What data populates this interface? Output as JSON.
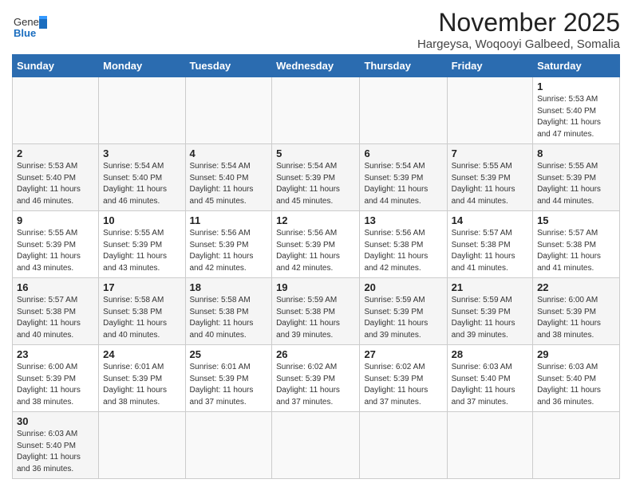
{
  "logo": {
    "general": "General",
    "blue": "Blue"
  },
  "title": "November 2025",
  "subtitle": "Hargeysa, Woqooyi Galbeed, Somalia",
  "header_days": [
    "Sunday",
    "Monday",
    "Tuesday",
    "Wednesday",
    "Thursday",
    "Friday",
    "Saturday"
  ],
  "weeks": [
    [
      {
        "day": "",
        "info": ""
      },
      {
        "day": "",
        "info": ""
      },
      {
        "day": "",
        "info": ""
      },
      {
        "day": "",
        "info": ""
      },
      {
        "day": "",
        "info": ""
      },
      {
        "day": "",
        "info": ""
      },
      {
        "day": "1",
        "info": "Sunrise: 5:53 AM\nSunset: 5:40 PM\nDaylight: 11 hours\nand 47 minutes."
      }
    ],
    [
      {
        "day": "2",
        "info": "Sunrise: 5:53 AM\nSunset: 5:40 PM\nDaylight: 11 hours\nand 46 minutes."
      },
      {
        "day": "3",
        "info": "Sunrise: 5:54 AM\nSunset: 5:40 PM\nDaylight: 11 hours\nand 46 minutes."
      },
      {
        "day": "4",
        "info": "Sunrise: 5:54 AM\nSunset: 5:40 PM\nDaylight: 11 hours\nand 45 minutes."
      },
      {
        "day": "5",
        "info": "Sunrise: 5:54 AM\nSunset: 5:39 PM\nDaylight: 11 hours\nand 45 minutes."
      },
      {
        "day": "6",
        "info": "Sunrise: 5:54 AM\nSunset: 5:39 PM\nDaylight: 11 hours\nand 44 minutes."
      },
      {
        "day": "7",
        "info": "Sunrise: 5:55 AM\nSunset: 5:39 PM\nDaylight: 11 hours\nand 44 minutes."
      },
      {
        "day": "8",
        "info": "Sunrise: 5:55 AM\nSunset: 5:39 PM\nDaylight: 11 hours\nand 44 minutes."
      }
    ],
    [
      {
        "day": "9",
        "info": "Sunrise: 5:55 AM\nSunset: 5:39 PM\nDaylight: 11 hours\nand 43 minutes."
      },
      {
        "day": "10",
        "info": "Sunrise: 5:55 AM\nSunset: 5:39 PM\nDaylight: 11 hours\nand 43 minutes."
      },
      {
        "day": "11",
        "info": "Sunrise: 5:56 AM\nSunset: 5:39 PM\nDaylight: 11 hours\nand 42 minutes."
      },
      {
        "day": "12",
        "info": "Sunrise: 5:56 AM\nSunset: 5:39 PM\nDaylight: 11 hours\nand 42 minutes."
      },
      {
        "day": "13",
        "info": "Sunrise: 5:56 AM\nSunset: 5:38 PM\nDaylight: 11 hours\nand 42 minutes."
      },
      {
        "day": "14",
        "info": "Sunrise: 5:57 AM\nSunset: 5:38 PM\nDaylight: 11 hours\nand 41 minutes."
      },
      {
        "day": "15",
        "info": "Sunrise: 5:57 AM\nSunset: 5:38 PM\nDaylight: 11 hours\nand 41 minutes."
      }
    ],
    [
      {
        "day": "16",
        "info": "Sunrise: 5:57 AM\nSunset: 5:38 PM\nDaylight: 11 hours\nand 40 minutes."
      },
      {
        "day": "17",
        "info": "Sunrise: 5:58 AM\nSunset: 5:38 PM\nDaylight: 11 hours\nand 40 minutes."
      },
      {
        "day": "18",
        "info": "Sunrise: 5:58 AM\nSunset: 5:38 PM\nDaylight: 11 hours\nand 40 minutes."
      },
      {
        "day": "19",
        "info": "Sunrise: 5:59 AM\nSunset: 5:38 PM\nDaylight: 11 hours\nand 39 minutes."
      },
      {
        "day": "20",
        "info": "Sunrise: 5:59 AM\nSunset: 5:39 PM\nDaylight: 11 hours\nand 39 minutes."
      },
      {
        "day": "21",
        "info": "Sunrise: 5:59 AM\nSunset: 5:39 PM\nDaylight: 11 hours\nand 39 minutes."
      },
      {
        "day": "22",
        "info": "Sunrise: 6:00 AM\nSunset: 5:39 PM\nDaylight: 11 hours\nand 38 minutes."
      }
    ],
    [
      {
        "day": "23",
        "info": "Sunrise: 6:00 AM\nSunset: 5:39 PM\nDaylight: 11 hours\nand 38 minutes."
      },
      {
        "day": "24",
        "info": "Sunrise: 6:01 AM\nSunset: 5:39 PM\nDaylight: 11 hours\nand 38 minutes."
      },
      {
        "day": "25",
        "info": "Sunrise: 6:01 AM\nSunset: 5:39 PM\nDaylight: 11 hours\nand 37 minutes."
      },
      {
        "day": "26",
        "info": "Sunrise: 6:02 AM\nSunset: 5:39 PM\nDaylight: 11 hours\nand 37 minutes."
      },
      {
        "day": "27",
        "info": "Sunrise: 6:02 AM\nSunset: 5:39 PM\nDaylight: 11 hours\nand 37 minutes."
      },
      {
        "day": "28",
        "info": "Sunrise: 6:03 AM\nSunset: 5:40 PM\nDaylight: 11 hours\nand 37 minutes."
      },
      {
        "day": "29",
        "info": "Sunrise: 6:03 AM\nSunset: 5:40 PM\nDaylight: 11 hours\nand 36 minutes."
      }
    ],
    [
      {
        "day": "30",
        "info": "Sunrise: 6:03 AM\nSunset: 5:40 PM\nDaylight: 11 hours\nand 36 minutes."
      },
      {
        "day": "",
        "info": ""
      },
      {
        "day": "",
        "info": ""
      },
      {
        "day": "",
        "info": ""
      },
      {
        "day": "",
        "info": ""
      },
      {
        "day": "",
        "info": ""
      },
      {
        "day": "",
        "info": ""
      }
    ]
  ]
}
